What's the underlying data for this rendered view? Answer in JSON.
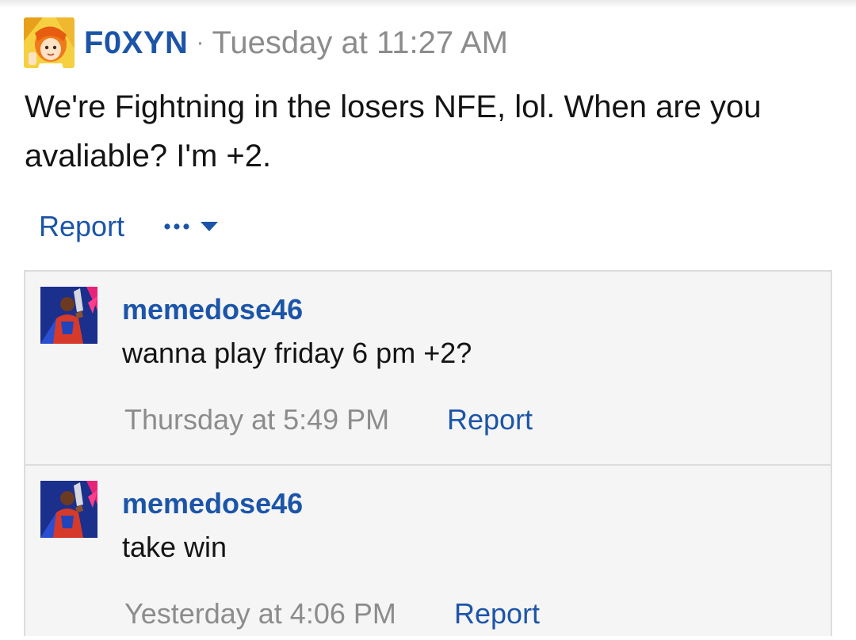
{
  "post": {
    "author": "F0XYN",
    "separator": "·",
    "timestamp": "Tuesday at 11:27 AM",
    "body": "We're Fightning in the losers NFE, lol. When are you avaliable? I'm +2.",
    "report_label": "Report",
    "more_label": "•••",
    "more_icon": "caret-down-icon"
  },
  "comments": [
    {
      "author": "memedose46",
      "text": "wanna play friday 6 pm +2?",
      "timestamp": "Thursday at 5:49 PM",
      "report_label": "Report"
    },
    {
      "author": "memedose46",
      "text": "take win",
      "timestamp": "Yesterday at 4:06 PM",
      "report_label": "Report"
    }
  ],
  "colors": {
    "link": "#1c55a8",
    "muted": "#8c8c8c",
    "text": "#141414",
    "comment_bg": "#f5f5f5",
    "border": "#dcdcdc"
  }
}
